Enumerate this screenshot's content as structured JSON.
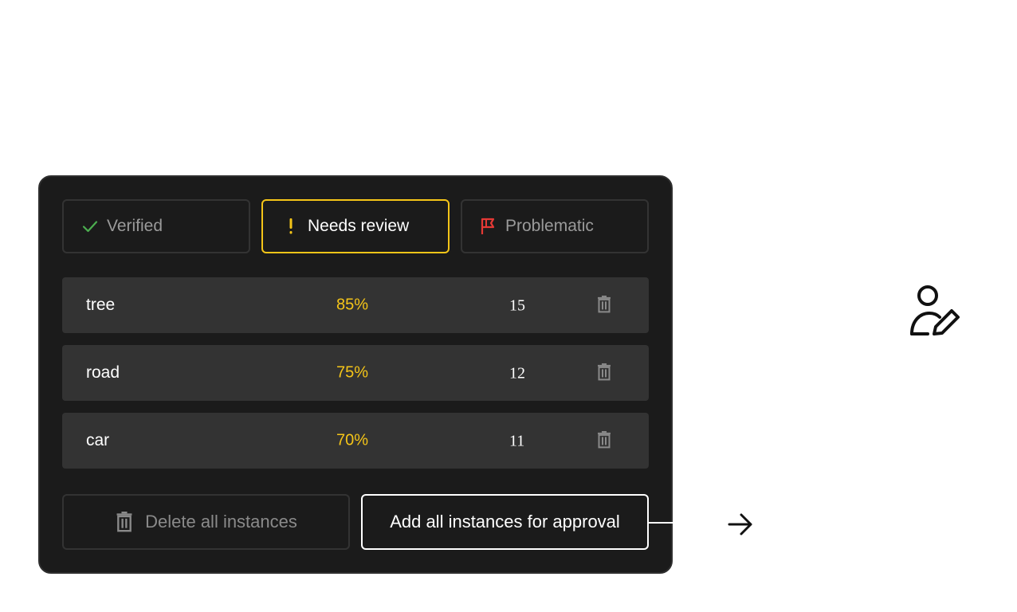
{
  "tabs": [
    {
      "label": "Verified",
      "icon": "check-icon",
      "color": "#4caf50"
    },
    {
      "label": "Needs review",
      "icon": "exclamation-icon",
      "color": "#f5c518"
    },
    {
      "label": "Problematic",
      "icon": "flag-icon",
      "color": "#e53935"
    }
  ],
  "rows": [
    {
      "label": "tree",
      "percent": "85%",
      "count": "15"
    },
    {
      "label": "road",
      "percent": "75%",
      "count": "12"
    },
    {
      "label": "car",
      "percent": "70%",
      "count": "11"
    }
  ],
  "actions": {
    "delete_all": "Delete all instances",
    "approve_all": "Add all instances for approval"
  },
  "colors": {
    "accent": "#f5c518",
    "panel_bg": "#1b1b1b",
    "row_bg": "#333333"
  }
}
